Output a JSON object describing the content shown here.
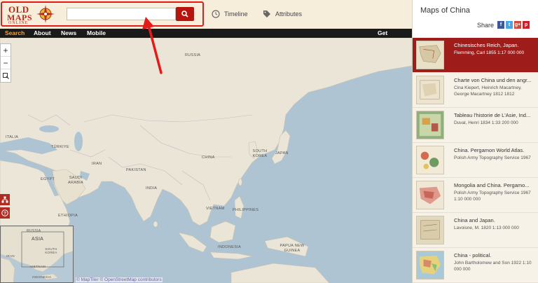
{
  "logo": {
    "line1": "OLD",
    "line2": "MAPS",
    "line3": "ONLINE"
  },
  "search": {
    "value": "",
    "placeholder": ""
  },
  "header_links": {
    "timeline": "Timeline",
    "attributes": "Attributes"
  },
  "nav": {
    "search": "Search",
    "about": "About",
    "news": "News",
    "mobile": "Mobile",
    "get_involved": "Get involved"
  },
  "map_labels": {
    "russia": "RUSSIA",
    "italia": "ITALIA",
    "turkiye": "TÜRKIYE",
    "china": "CHINA",
    "south_korea": "SOUTH KOREA",
    "japan": "JAPAN",
    "iran": "IRAN",
    "pakistan": "PAKISTAN",
    "egypt": "EGYPT",
    "saudi_arabia": "SAUDI ARABIA",
    "india": "INDIA",
    "ethiopia": "ETHIOPIA",
    "vietnam": "VIETNAM",
    "philippines": "PHILIPPINES",
    "indonesia": "INDONESIA",
    "papua_new_guinea": "PAPUA NEW GUINEA"
  },
  "inset_labels": {
    "russia": "RUSSIA",
    "asia": "ASIA",
    "south_korea": "SOUTH KOREA",
    "iran": "IRAN",
    "vietnam": "VIETNAM",
    "indonesia": "INDONESIA"
  },
  "attribution": "© MapTiler © OpenStreetMap contributors",
  "panel": {
    "title_prefix": "Maps of ",
    "title_place": "China",
    "share_label": "Share",
    "share_icons": [
      "f",
      "t",
      "g+",
      "p"
    ]
  },
  "maps": [
    {
      "title": "Chinesisches Reich, Japan.",
      "meta": "Flemming, Carl 1855 1:17 000 000",
      "selected": true
    },
    {
      "title": "Charte von China und den angr...",
      "meta": "Cina Kiepert, Heinrich Macartney, George Macartney 1812 1812",
      "selected": false
    },
    {
      "title": "Tableau l'historie de L'Asie, Ind...",
      "meta": "Duval, Henri 1834 1:33 200 000",
      "selected": false
    },
    {
      "title": "China. Pergamon World Atlas.",
      "meta": "Polish Army Topography Service 1967",
      "selected": false
    },
    {
      "title": "Mongolia and China. Pergamo...",
      "meta": "Polish Army Topography Service 1967 1:10 000 000",
      "selected": false
    },
    {
      "title": "China and Japan.",
      "meta": "Lavoisne, M. 1820 1:13 000 000",
      "selected": false
    },
    {
      "title": "China - political.",
      "meta": "John Bartholomew and Son 1922 1:10 000 000",
      "selected": false
    }
  ],
  "colors": {
    "accent": "#b5140f",
    "annotation": "#e31b1b",
    "nav_active": "#f0a23a"
  }
}
